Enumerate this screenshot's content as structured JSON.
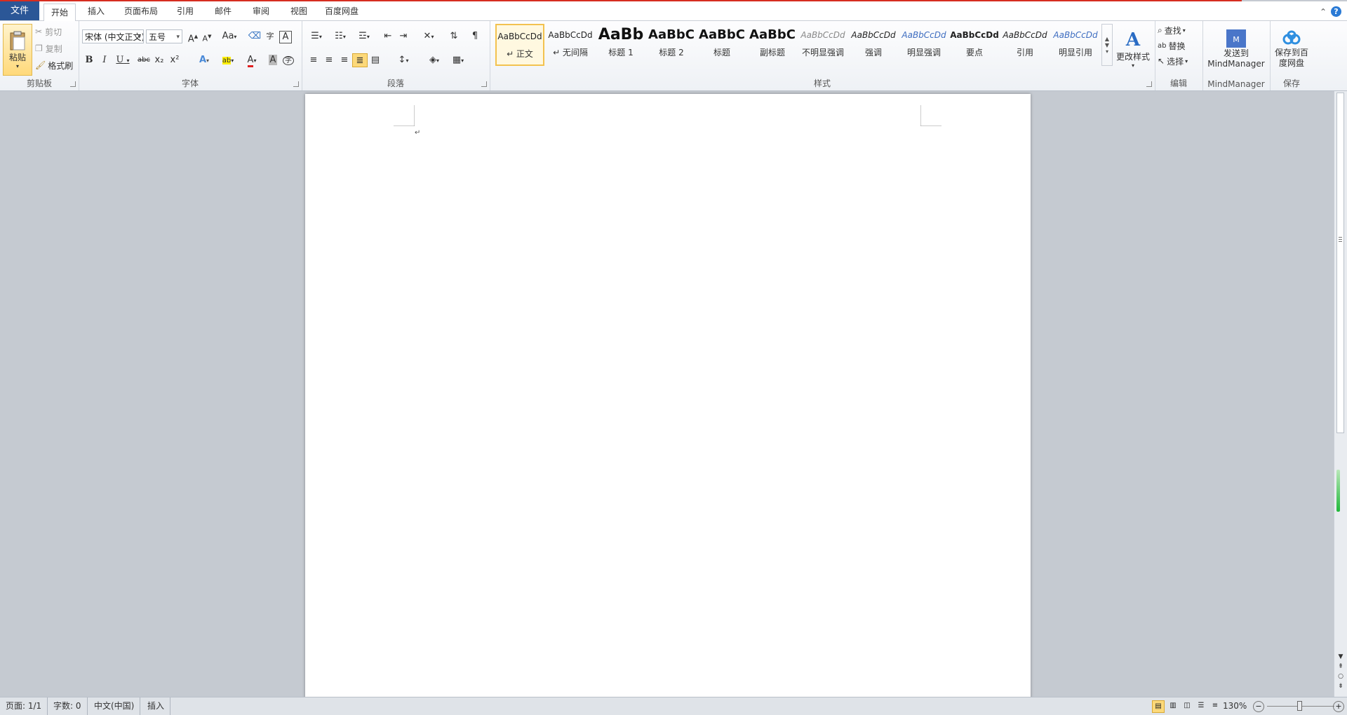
{
  "tabs": {
    "file": "文件",
    "items": [
      "开始",
      "插入",
      "页面布局",
      "引用",
      "邮件",
      "审阅",
      "视图",
      "百度网盘"
    ],
    "active_index": 0
  },
  "clipboard": {
    "paste": "粘贴",
    "cut": "剪切",
    "copy": "复制",
    "format_painter": "格式刷",
    "label": "剪贴板"
  },
  "font": {
    "family": "宋体 (中文正文)",
    "size": "五号",
    "label": "字体",
    "change_case": "Aa",
    "bold": "B",
    "italic": "I",
    "underline": "U",
    "strike": "abc",
    "subscript": "x₂",
    "superscript": "x²",
    "grow": "A",
    "shrink": "A",
    "phonetic": "A",
    "enclose": "字",
    "char_border": "A",
    "char_shading": "A",
    "highlight": "ab",
    "font_color": "A"
  },
  "paragraph": {
    "label": "段落"
  },
  "styles": {
    "label": "样式",
    "items": [
      {
        "sample": "AaBbCcDd",
        "name": "↵ 正文",
        "size": 12,
        "bold": false,
        "italic": false,
        "color": "#222",
        "selected": true
      },
      {
        "sample": "AaBbCcDd",
        "name": "↵ 无间隔",
        "size": 12,
        "bold": false,
        "italic": false,
        "color": "#222",
        "selected": false
      },
      {
        "sample": "AaBb",
        "name": "标题 1",
        "size": 22,
        "bold": true,
        "italic": false,
        "color": "#111",
        "selected": false
      },
      {
        "sample": "AaBbC",
        "name": "标题 2",
        "size": 18,
        "bold": true,
        "italic": false,
        "color": "#111",
        "selected": false
      },
      {
        "sample": "AaBbC",
        "name": "标题",
        "size": 18,
        "bold": true,
        "italic": false,
        "color": "#111",
        "selected": false
      },
      {
        "sample": "AaBbC",
        "name": "副标题",
        "size": 18,
        "bold": true,
        "italic": false,
        "color": "#111",
        "selected": false
      },
      {
        "sample": "AaBbCcDd",
        "name": "不明显强调",
        "size": 12,
        "bold": false,
        "italic": true,
        "color": "#888",
        "selected": false
      },
      {
        "sample": "AaBbCcDd",
        "name": "强调",
        "size": 12,
        "bold": false,
        "italic": true,
        "color": "#222",
        "selected": false
      },
      {
        "sample": "AaBbCcDd",
        "name": "明显强调",
        "size": 12,
        "bold": false,
        "italic": true,
        "color": "#3d6cc0",
        "selected": false
      },
      {
        "sample": "AaBbCcDd",
        "name": "要点",
        "size": 12,
        "bold": true,
        "italic": false,
        "color": "#222",
        "selected": false
      },
      {
        "sample": "AaBbCcDd",
        "name": "引用",
        "size": 12,
        "bold": false,
        "italic": true,
        "color": "#222",
        "selected": false
      },
      {
        "sample": "AaBbCcDd",
        "name": "明显引用",
        "size": 12,
        "bold": false,
        "italic": true,
        "color": "#3d6cc0",
        "selected": false
      }
    ],
    "change_styles": "更改样式"
  },
  "editing": {
    "find": "查找",
    "replace": "替换",
    "select": "选择",
    "label": "编辑"
  },
  "mindmanager": {
    "send": "发送到\nMindManager",
    "label": "MindManager"
  },
  "save": {
    "baidu": "保存到百\n度网盘",
    "label": "保存"
  },
  "document": {
    "paragraph_mark": "↵"
  },
  "status": {
    "page": "页面: 1/1",
    "words": "字数: 0",
    "language": "中文(中国)",
    "mode": "插入",
    "zoom": "130%"
  }
}
